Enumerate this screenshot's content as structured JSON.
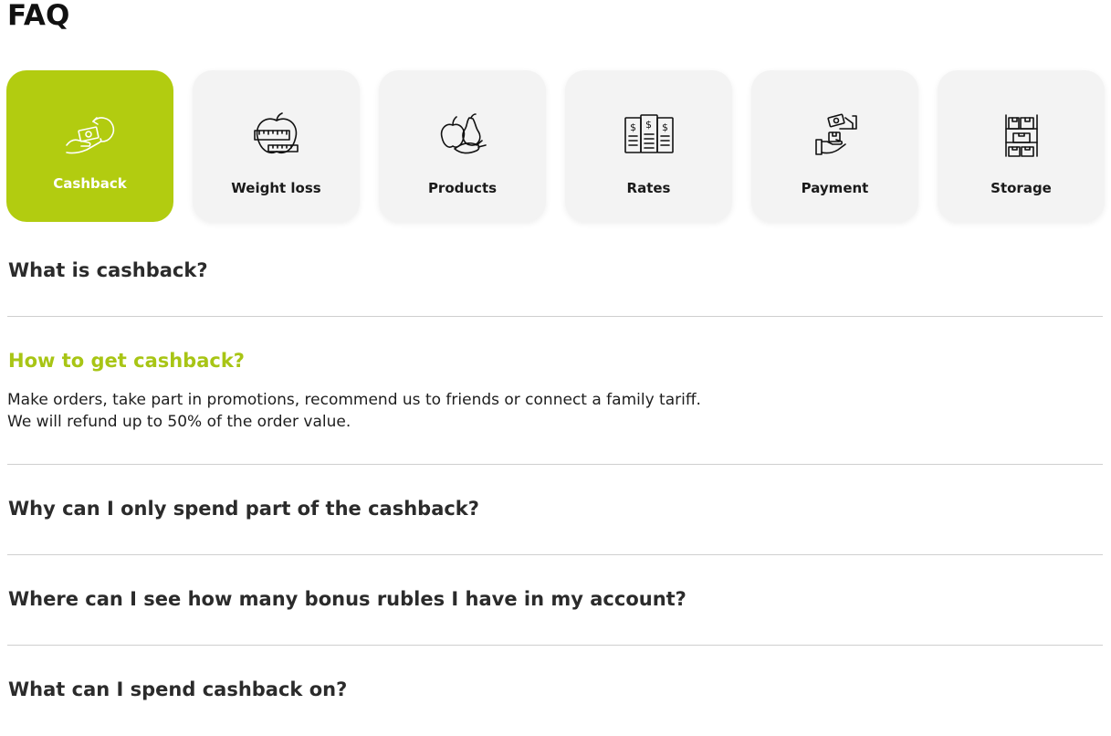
{
  "page": {
    "title": "FAQ"
  },
  "colors": {
    "accent": "#b2cc10",
    "accent_text": "#a8c515",
    "tile_bg": "#f3f3f3",
    "divider": "#cfcfcf"
  },
  "categories": [
    {
      "label": "Cashback",
      "icon": "cashback-hand-money-icon",
      "active": true
    },
    {
      "label": "Weight loss",
      "icon": "apple-measuring-tape-icon",
      "active": false
    },
    {
      "label": "Products",
      "icon": "fruits-vegetables-icon",
      "active": false
    },
    {
      "label": "Rates",
      "icon": "price-menu-icon",
      "active": false
    },
    {
      "label": "Payment",
      "icon": "hand-payment-icon",
      "active": false
    },
    {
      "label": "Storage",
      "icon": "storage-shelves-icon",
      "active": false
    }
  ],
  "faq": [
    {
      "question": "What is cashback?",
      "open": false
    },
    {
      "question": "How to get cashback?",
      "open": true,
      "answer": "Make orders, take part in promotions, recommend us to friends or connect a family tariff. We will refund up to 50% of the order value."
    },
    {
      "question": "Why can I only spend part of the cashback?",
      "open": false
    },
    {
      "question": "Where can I see how many bonus rubles I have in my account?",
      "open": false
    },
    {
      "question": "What can I spend cashback on?",
      "open": false
    }
  ]
}
